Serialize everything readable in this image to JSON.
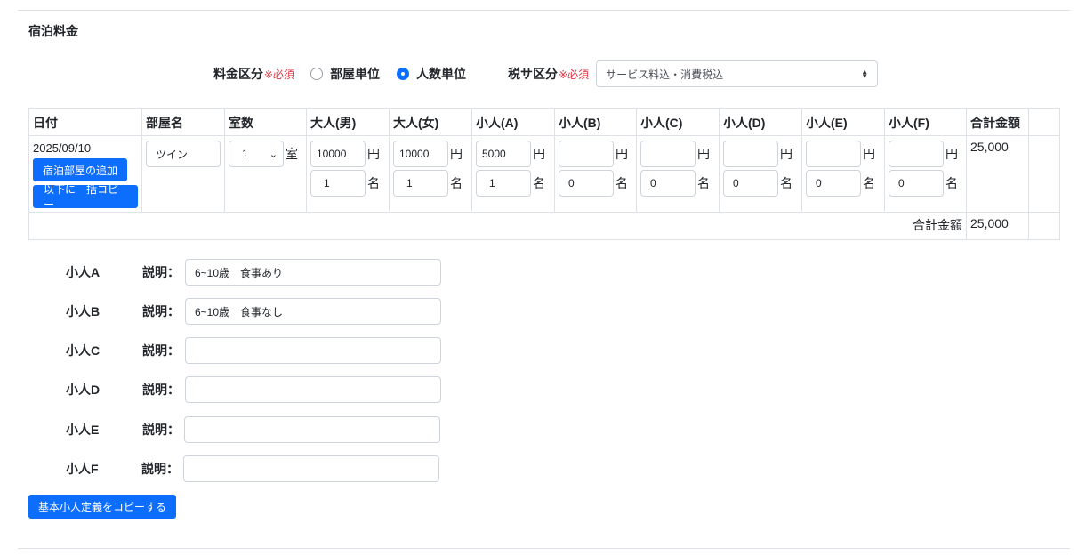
{
  "section_title": "宿泊料金",
  "price_type": {
    "label": "料金区分",
    "required": "※必須",
    "options": [
      "部屋単位",
      "人数単位"
    ],
    "selected": "人数単位"
  },
  "tax_type": {
    "label": "税サ区分",
    "required": "※必須",
    "value": "サービス料込・消費税込"
  },
  "table": {
    "headers": [
      "日付",
      "部屋名",
      "室数",
      "大人(男)",
      "大人(女)",
      "小人(A)",
      "小人(B)",
      "小人(C)",
      "小人(D)",
      "小人(E)",
      "小人(F)",
      "合計金額"
    ],
    "row": {
      "date": "2025/09/10",
      "add_room_button": "宿泊部屋の追加",
      "copy_below_button": "以下に一括コピー",
      "room_name": "ツイン",
      "room_count": "1",
      "room_unit": "室",
      "yen_unit": "円",
      "person_unit": "名",
      "prices": [
        "10000",
        "10000",
        "5000",
        "",
        "",
        "",
        "",
        ""
      ],
      "counts": [
        "1",
        "1",
        "1",
        "0",
        "0",
        "0",
        "0",
        "0"
      ],
      "total": "25,000"
    },
    "footer_label": "合計金額",
    "footer_total": "25,000"
  },
  "child_descriptions": {
    "desc_label": "説明：",
    "items": [
      {
        "name": "小人A",
        "value": "6~10歳　食事あり"
      },
      {
        "name": "小人B",
        "value": "6~10歳　食事なし"
      },
      {
        "name": "小人C",
        "value": ""
      },
      {
        "name": "小人D",
        "value": ""
      },
      {
        "name": "小人E",
        "value": ""
      },
      {
        "name": "小人F",
        "value": ""
      }
    ]
  },
  "copy_defaults_button": "基本小人定義をコピーする",
  "colors": {
    "primary": "#0d6efd",
    "required": "#dc3545",
    "border": "#dee2e6"
  }
}
